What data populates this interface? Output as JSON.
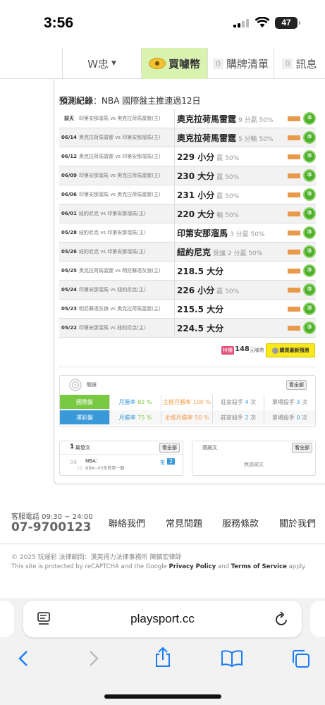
{
  "status_bar": {
    "time": "3:56",
    "battery": "47"
  },
  "top_nav": {
    "user": "W忠",
    "buy_coins": "買噱幣",
    "cart": {
      "count": "0",
      "label": "購牌清單"
    },
    "messages": {
      "count": "0",
      "label": "訊息"
    }
  },
  "prediction": {
    "title_bold": "預測紀錄",
    "title_rest": "：NBA 國際盤主推連過12日",
    "rows": [
      {
        "date": "前天",
        "match": "印第安那溜馬 vs 奧克拉荷馬雷霆(主)",
        "pick": "奧克拉荷馬雷霆",
        "result": "9 分贏 50%"
      },
      {
        "date": "06/14",
        "match": "奧克拉荷馬雷霆 vs 印第安那溜馬(主)",
        "pick": "奧克拉荷馬雷霆",
        "result": "5 分輸 50%"
      },
      {
        "date": "06/12",
        "match": "奧克拉荷馬雷霆 vs 印第安那溜馬(主)",
        "pick": "229 小分",
        "result": "贏 50%"
      },
      {
        "date": "06/09",
        "match": "印第安那溜馬 vs 奧克拉荷馬雷霆(主)",
        "pick": "230 大分",
        "result": "贏 50%"
      },
      {
        "date": "06/06",
        "match": "印第安那溜馬 vs 奧克拉荷馬雷霆(主)",
        "pick": "231 小分",
        "result": "贏 50%"
      },
      {
        "date": "06/01",
        "match": "紐約尼克 vs 印第安那溜馬(主)",
        "pick": "220 大分",
        "result": "輸 50%"
      },
      {
        "date": "05/28",
        "match": "紐約尼克 vs 印第安那溜馬(主)",
        "pick": "印第安那溜馬",
        "result": "3 分贏 50%"
      },
      {
        "date": "05/26",
        "match": "紐約尼克 vs 印第安那溜馬(主)",
        "pick": "紐約尼克",
        "result": "受讓 2 分贏 50%"
      },
      {
        "date": "05/25",
        "match": "奧克拉荷馬雷霆 vs 明尼蘇達灰狼(主)",
        "pick": "218.5 大分",
        "result": ""
      },
      {
        "date": "05/24",
        "match": "印第安那溜馬 vs 紐約尼克(主)",
        "pick": "226 小分",
        "result": "贏 50%"
      },
      {
        "date": "05/23",
        "match": "明尼蘇達灰狼 vs 奧克拉荷馬雷霆(主)",
        "pick": "215.5 大分",
        "result": ""
      },
      {
        "date": "05/22",
        "match": "印第安那溜馬 vs 紐約尼克(主)",
        "pick": "224.5 大分",
        "result": ""
      }
    ],
    "status_glyph": "準",
    "price_tag": "特價",
    "price": "148",
    "price_unit": "元噱幣",
    "buy_button": "購買最新預測"
  },
  "record": {
    "title": "戰績",
    "view_all": "看全部",
    "rows": [
      {
        "label": "國際盤",
        "color": "#7ac943",
        "monthly": "月勝率",
        "monthly_v": "82 %",
        "main": "主推月勝率",
        "main_v": "100 %",
        "dealer": "莊家殺手",
        "dealer_v": "4",
        "unit": "次",
        "single": "單場殺手",
        "single_v": "3"
      },
      {
        "label": "運彩盤",
        "color": "#3a9ad9",
        "monthly": "月勝率",
        "monthly_v": "75 %",
        "main": "主推月勝率",
        "main_v": "50 %",
        "dealer": "莊家殺手",
        "dealer_v": "2",
        "unit": "次",
        "single": "單場殺手",
        "single_v": "0"
      }
    ]
  },
  "articles": {
    "count": "1",
    "label": "篇發文",
    "view_all": "看全部",
    "item_day": "06",
    "item_month": "10",
    "item_title": "NBA：",
    "item_sub": "NBA~05免費第一顆",
    "item_tag": "推",
    "item_num": "2"
  },
  "received": {
    "label": "感謝文",
    "view_all": "看全部",
    "empty": "無感謝文"
  },
  "footer": {
    "hotline_label": "客服電話 09:30 ~ 24:00",
    "hotline": "07-9700123",
    "links": [
      "聯絡我們",
      "常見問題",
      "服務條款",
      "關於我們"
    ],
    "copyright": "© 2025 玩運彩 法律顧問：漢英得力法律事務所 陳鎮宏律師",
    "recaptcha_pre": "This site is protected by reCAPTCHA and the Google ",
    "privacy": "Privacy Policy",
    "and": " and ",
    "terms": "Terms of Service",
    "apply": " apply."
  },
  "browser": {
    "url": "playsport.cc"
  }
}
